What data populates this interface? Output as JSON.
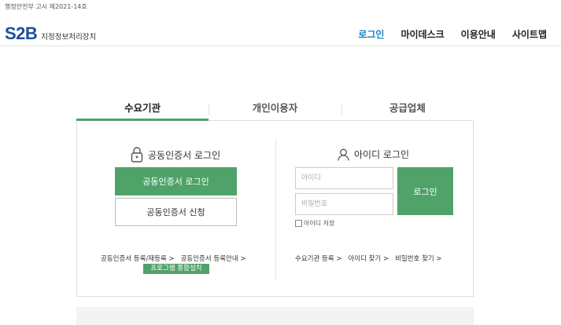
{
  "header": {
    "notice": "행정안전부 고시 제2021-14호",
    "logo_mark": "S2B",
    "logo_sub": "지정정보처리장치",
    "nav": [
      "로그인",
      "마이데스크",
      "이용안내",
      "사이트맵"
    ]
  },
  "tabs": [
    "수요기관",
    "개인이용자",
    "공급업체"
  ],
  "cert_login": {
    "title": "공동인증서 로그인",
    "login_button": "공동인증서 로그인",
    "apply_button": "공동인증서 신청",
    "link_register": "공동인증서 등록/재등록 >",
    "link_guide": "공동인증서 등록안내 >",
    "badge": "프로그램 통합설치"
  },
  "id_login": {
    "title": "아이디 로그인",
    "id_placeholder": "아이디",
    "pw_placeholder": "비밀번호",
    "login_button": "로그인",
    "save_id": "아이디 저장",
    "link_register": "수요기관 등록 >",
    "link_find_id": "아이디 찾기 >",
    "link_find_pw": "비밀번호 찾기 >"
  },
  "colors": {
    "brand": "#1f4e9c",
    "accent": "#4fa368",
    "nav_active": "#1a7fc1"
  }
}
